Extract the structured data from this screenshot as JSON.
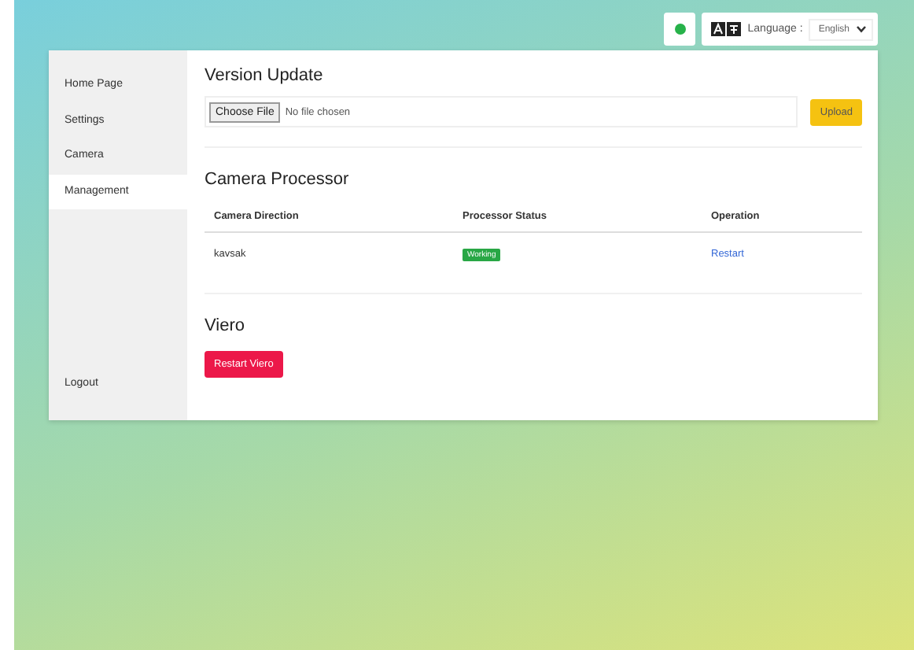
{
  "top_bar": {
    "connected": true,
    "language_label": "Language :",
    "language_value": "English"
  },
  "sidebar": {
    "items": [
      {
        "label": "Home Page",
        "selected": false
      },
      {
        "label": "Settings",
        "selected": false
      },
      {
        "label": "Camera",
        "selected": false
      },
      {
        "label": "Management",
        "selected": true
      }
    ],
    "logout": "Logout"
  },
  "version_update": {
    "title": "Version Update",
    "choose_file": "Choose File",
    "file_status": "No file chosen",
    "upload": "Upload"
  },
  "camera_processor": {
    "title": "Camera Processor",
    "columns": [
      "Camera Direction",
      "Processor Status",
      "Operation"
    ],
    "rows": [
      {
        "direction": "kavsak",
        "status": "Working",
        "color": "#28a745",
        "operation": "Restart"
      }
    ]
  },
  "viero": {
    "title": "Viero",
    "restart": "Restart Viero"
  }
}
